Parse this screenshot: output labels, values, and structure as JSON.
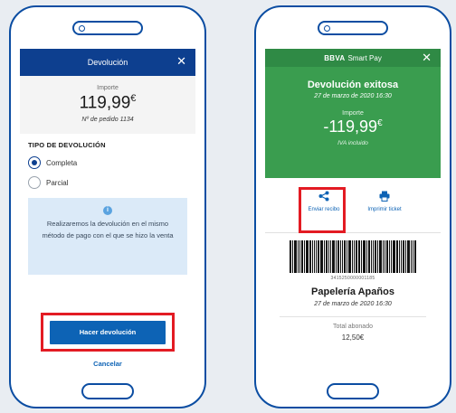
{
  "left_screen": {
    "header_title": "Devolución",
    "close_symbol": "✕",
    "amount_label": "Importe",
    "amount_value": "119,99",
    "currency": "€",
    "order_number": "Nº de pedido 1134",
    "section_title": "TIPO DE DEVOLUCIÓN",
    "options": [
      {
        "label": "Completa",
        "selected": true
      },
      {
        "label": "Parcial",
        "selected": false
      }
    ],
    "info_icon": "i",
    "info_text": "Realizaremos la devolución en el mismo método de pago con el que se hizo la venta",
    "primary_button": "Hacer devolución",
    "cancel_link": "Cancelar"
  },
  "right_screen": {
    "brand": "BBVA",
    "brand_suffix": "Smart Pay",
    "close_symbol": "✕",
    "success_title": "Devolución exitosa",
    "success_date": "27 de marzo de 2020 16:30",
    "amount_label": "Importe",
    "amount_value": "-119,99",
    "currency": "€",
    "tax_note": "IVA incluido",
    "actions": [
      {
        "label": "Enviar recibo",
        "icon": "share-icon"
      },
      {
        "label": "Imprimir ticket",
        "icon": "printer-icon"
      }
    ],
    "barcode_number": "3415250000001185",
    "merchant": "Papelería Apaños",
    "merchant_date": "27 de marzo de 2020 16:30",
    "total_label": "Total abonado",
    "total_value": "12,50€"
  },
  "colors": {
    "phone_outline": "#0b4da2",
    "header_blue": "#0d3f8f",
    "success_green": "#3a9d4f",
    "highlight_red": "#e31b23",
    "link_blue": "#0d63b5"
  }
}
